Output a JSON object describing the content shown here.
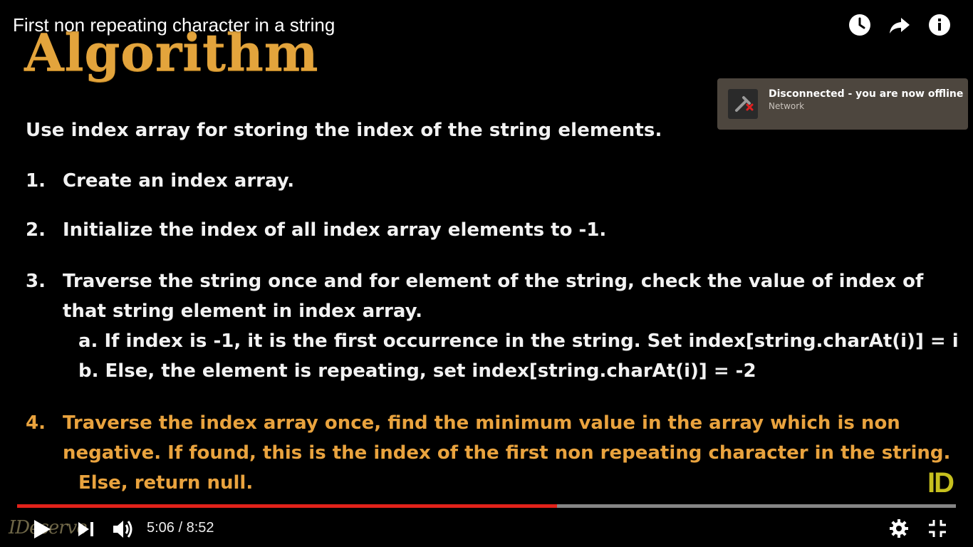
{
  "video": {
    "title": "First non repeating character in a string"
  },
  "slide": {
    "heading": "Algorithm",
    "intro": "Use index array for storing the index of the string elements.",
    "steps": [
      {
        "num": "1.",
        "text": "Create an index array."
      },
      {
        "num": "2.",
        "text": "Initialize the index of all index array elements to -1."
      },
      {
        "num": "3.",
        "line1": "Traverse the string once and for element of the string, check the value of index of",
        "line2": "that string element in index array.",
        "sub_a": "a. If index is -1, it is the first occurrence in the string. Set index[string.charAt(i)] = i",
        "sub_b": "b. Else, the element is repeating, set index[string.charAt(i)] = -2"
      },
      {
        "num": "4.",
        "line1": "Traverse the index array once, find the minimum value in the array which is non",
        "line2": "negative. If found, this is the index of the first non repeating character in the string.",
        "line3": "Else, return null."
      }
    ],
    "logo": "ID",
    "watermark": "IDeserve"
  },
  "top_actions": {
    "icons": [
      "watch-later-icon",
      "share-icon",
      "info-icon"
    ]
  },
  "notification": {
    "title": "Disconnected - you are now offline",
    "subtitle": "Network",
    "icon": "network-disconnected-icon"
  },
  "player": {
    "current_time": "5:06",
    "duration": "8:52",
    "time_display": "5:06 / 8:52",
    "progress_fraction": 0.575,
    "played_color": "#e2221a"
  },
  "colors": {
    "accent_orange": "#e9a33e",
    "logo_yellow": "#c6c01e",
    "notification_bg": "#4d463e"
  }
}
